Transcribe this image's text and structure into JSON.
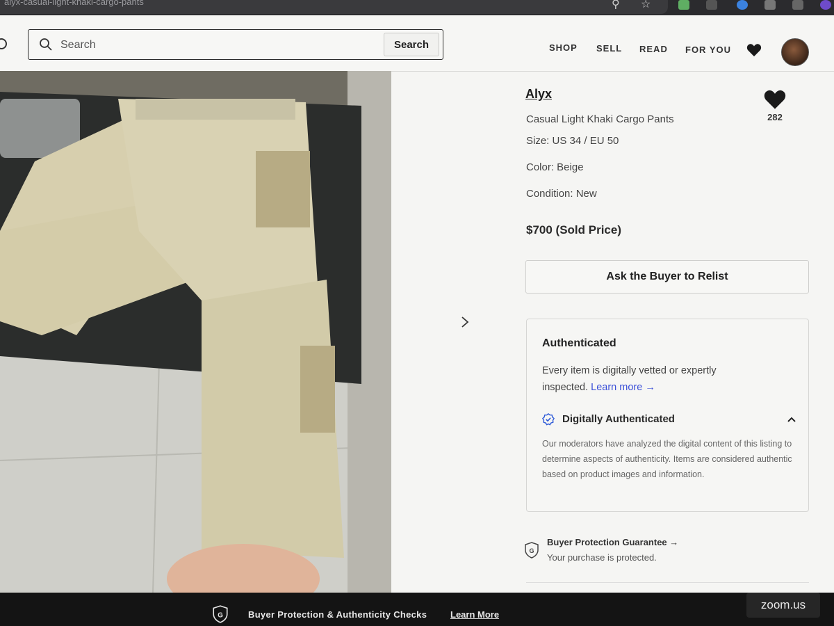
{
  "browser": {
    "url_fragment": "alyx-casual-light-khaki-cargo-pants"
  },
  "header": {
    "search": {
      "placeholder": "Search",
      "button_label": "Search"
    },
    "nav": [
      "SHOP",
      "SELL",
      "READ",
      "FOR YOU"
    ]
  },
  "listing": {
    "brand": "Alyx",
    "title": "Casual Light Khaki Cargo Pants",
    "favorites_count": "282",
    "size": "Size: US 34 / EU 50",
    "color": "Color: Beige",
    "condition": "Condition: New",
    "price": "$700 (Sold Price)",
    "relist_button": "Ask the Buyer to Relist"
  },
  "authentication": {
    "title": "Authenticated",
    "body": "Every item is digitally vetted or expertly inspected.",
    "learn_more": "Learn more →",
    "digital_label": "Digitally Authenticated",
    "digital_description": "Our moderators have analyzed the digital content of this listing to determine aspects of authenticity. Items are considered authentic based on product images and information."
  },
  "buyer_protection": {
    "title": "Buyer Protection Guarantee →",
    "subtitle": "Your purchase is protected."
  },
  "banner": {
    "text": "Buyer Protection & Authenticity Checks",
    "link": "Learn More"
  },
  "overlay": {
    "zoom_label": "zoom.us"
  },
  "colors": {
    "link": "#3a4fd8",
    "banner_bg": "#141414",
    "verified_blue": "#2f5bd8"
  }
}
